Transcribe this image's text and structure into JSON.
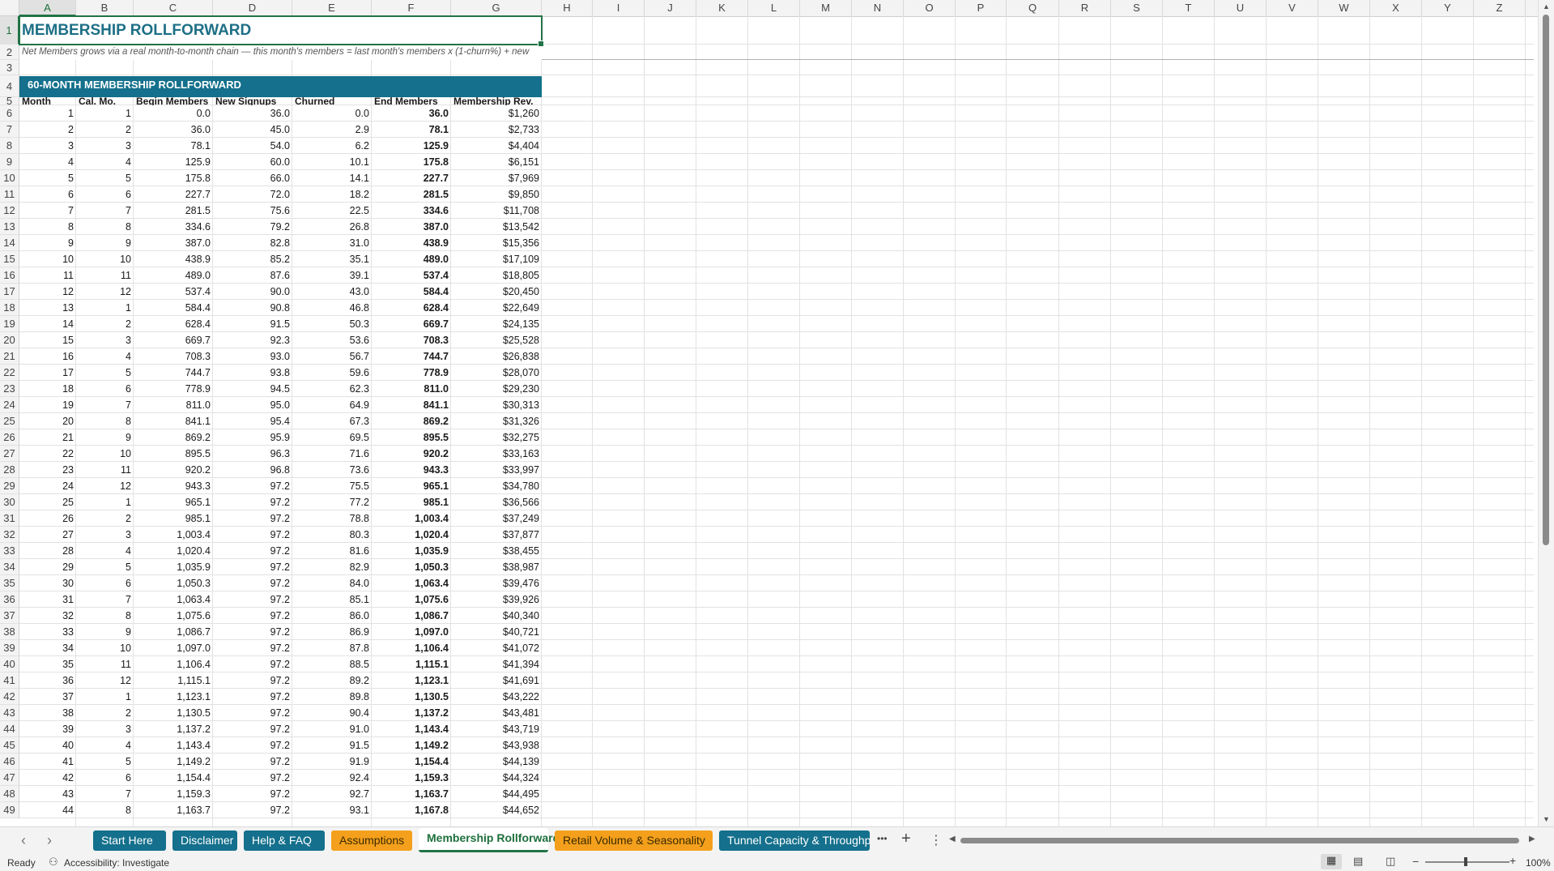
{
  "columns": [
    "A",
    "B",
    "C",
    "D",
    "E",
    "F",
    "G",
    "H",
    "I",
    "J",
    "K",
    "L",
    "M",
    "N",
    "O",
    "P",
    "Q",
    "R",
    "S",
    "T",
    "U",
    "V",
    "W",
    "X",
    "Y",
    "Z"
  ],
  "title": "MEMBERSHIP ROLLFORWARD",
  "subtitle": "Net Members grows via a real month-to-month chain — this month's members = last month's members x (1-churn%) + new",
  "banner": "60-MONTH MEMBERSHIP ROLLFORWARD",
  "headers": [
    "Month",
    "Cal. Mo.",
    "Begin Members",
    "New Signups",
    "Churned",
    "End Members",
    "Membership Rev."
  ],
  "rows": [
    [
      "1",
      "1",
      "0.0",
      "36.0",
      "0.0",
      "36.0",
      "$1,260"
    ],
    [
      "2",
      "2",
      "36.0",
      "45.0",
      "2.9",
      "78.1",
      "$2,733"
    ],
    [
      "3",
      "3",
      "78.1",
      "54.0",
      "6.2",
      "125.9",
      "$4,404"
    ],
    [
      "4",
      "4",
      "125.9",
      "60.0",
      "10.1",
      "175.8",
      "$6,151"
    ],
    [
      "5",
      "5",
      "175.8",
      "66.0",
      "14.1",
      "227.7",
      "$7,969"
    ],
    [
      "6",
      "6",
      "227.7",
      "72.0",
      "18.2",
      "281.5",
      "$9,850"
    ],
    [
      "7",
      "7",
      "281.5",
      "75.6",
      "22.5",
      "334.6",
      "$11,708"
    ],
    [
      "8",
      "8",
      "334.6",
      "79.2",
      "26.8",
      "387.0",
      "$13,542"
    ],
    [
      "9",
      "9",
      "387.0",
      "82.8",
      "31.0",
      "438.9",
      "$15,356"
    ],
    [
      "10",
      "10",
      "438.9",
      "85.2",
      "35.1",
      "489.0",
      "$17,109"
    ],
    [
      "11",
      "11",
      "489.0",
      "87.6",
      "39.1",
      "537.4",
      "$18,805"
    ],
    [
      "12",
      "12",
      "537.4",
      "90.0",
      "43.0",
      "584.4",
      "$20,450"
    ],
    [
      "13",
      "1",
      "584.4",
      "90.8",
      "46.8",
      "628.4",
      "$22,649"
    ],
    [
      "14",
      "2",
      "628.4",
      "91.5",
      "50.3",
      "669.7",
      "$24,135"
    ],
    [
      "15",
      "3",
      "669.7",
      "92.3",
      "53.6",
      "708.3",
      "$25,528"
    ],
    [
      "16",
      "4",
      "708.3",
      "93.0",
      "56.7",
      "744.7",
      "$26,838"
    ],
    [
      "17",
      "5",
      "744.7",
      "93.8",
      "59.6",
      "778.9",
      "$28,070"
    ],
    [
      "18",
      "6",
      "778.9",
      "94.5",
      "62.3",
      "811.0",
      "$29,230"
    ],
    [
      "19",
      "7",
      "811.0",
      "95.0",
      "64.9",
      "841.1",
      "$30,313"
    ],
    [
      "20",
      "8",
      "841.1",
      "95.4",
      "67.3",
      "869.2",
      "$31,326"
    ],
    [
      "21",
      "9",
      "869.2",
      "95.9",
      "69.5",
      "895.5",
      "$32,275"
    ],
    [
      "22",
      "10",
      "895.5",
      "96.3",
      "71.6",
      "920.2",
      "$33,163"
    ],
    [
      "23",
      "11",
      "920.2",
      "96.8",
      "73.6",
      "943.3",
      "$33,997"
    ],
    [
      "24",
      "12",
      "943.3",
      "97.2",
      "75.5",
      "965.1",
      "$34,780"
    ],
    [
      "25",
      "1",
      "965.1",
      "97.2",
      "77.2",
      "985.1",
      "$36,566"
    ],
    [
      "26",
      "2",
      "985.1",
      "97.2",
      "78.8",
      "1,003.4",
      "$37,249"
    ],
    [
      "27",
      "3",
      "1,003.4",
      "97.2",
      "80.3",
      "1,020.4",
      "$37,877"
    ],
    [
      "28",
      "4",
      "1,020.4",
      "97.2",
      "81.6",
      "1,035.9",
      "$38,455"
    ],
    [
      "29",
      "5",
      "1,035.9",
      "97.2",
      "82.9",
      "1,050.3",
      "$38,987"
    ],
    [
      "30",
      "6",
      "1,050.3",
      "97.2",
      "84.0",
      "1,063.4",
      "$39,476"
    ],
    [
      "31",
      "7",
      "1,063.4",
      "97.2",
      "85.1",
      "1,075.6",
      "$39,926"
    ],
    [
      "32",
      "8",
      "1,075.6",
      "97.2",
      "86.0",
      "1,086.7",
      "$40,340"
    ],
    [
      "33",
      "9",
      "1,086.7",
      "97.2",
      "86.9",
      "1,097.0",
      "$40,721"
    ],
    [
      "34",
      "10",
      "1,097.0",
      "97.2",
      "87.8",
      "1,106.4",
      "$41,072"
    ],
    [
      "35",
      "11",
      "1,106.4",
      "97.2",
      "88.5",
      "1,115.1",
      "$41,394"
    ],
    [
      "36",
      "12",
      "1,115.1",
      "97.2",
      "89.2",
      "1,123.1",
      "$41,691"
    ],
    [
      "37",
      "1",
      "1,123.1",
      "97.2",
      "89.8",
      "1,130.5",
      "$43,222"
    ],
    [
      "38",
      "2",
      "1,130.5",
      "97.2",
      "90.4",
      "1,137.2",
      "$43,481"
    ],
    [
      "39",
      "3",
      "1,137.2",
      "97.2",
      "91.0",
      "1,143.4",
      "$43,719"
    ],
    [
      "40",
      "4",
      "1,143.4",
      "97.2",
      "91.5",
      "1,149.2",
      "$43,938"
    ],
    [
      "41",
      "5",
      "1,149.2",
      "97.2",
      "91.9",
      "1,154.4",
      "$44,139"
    ],
    [
      "42",
      "6",
      "1,154.4",
      "97.2",
      "92.4",
      "1,159.3",
      "$44,324"
    ],
    [
      "43",
      "7",
      "1,159.3",
      "97.2",
      "92.7",
      "1,163.7",
      "$44,495"
    ],
    [
      "44",
      "8",
      "1,163.7",
      "97.2",
      "93.1",
      "1,167.8",
      "$44,652"
    ]
  ],
  "tabs": [
    {
      "label": "Start Here",
      "style": "teal"
    },
    {
      "label": "Disclaimer",
      "style": "teal"
    },
    {
      "label": "Help & FAQ",
      "style": "teal"
    },
    {
      "label": "Assumptions",
      "style": "orange"
    },
    {
      "label": "Membership Rollforward",
      "style": "active"
    },
    {
      "label": "Retail Volume & Seasonality",
      "style": "orange"
    },
    {
      "label": "Tunnel Capacity & Throughp",
      "style": "teal"
    }
  ],
  "tab_more": "•••",
  "tab_add": "+",
  "tab_menu": "⋮",
  "status": {
    "ready": "Ready",
    "accessibility": "Accessibility: Investigate",
    "zoom": "100%"
  },
  "colors": {
    "banner": "#14708c",
    "title": "#1d6f86",
    "accent": "#217346",
    "orange_tab": "#f4a01c"
  }
}
